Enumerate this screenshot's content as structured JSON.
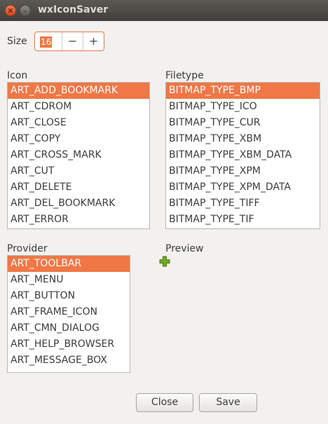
{
  "window": {
    "title": "wxIconSaver"
  },
  "size": {
    "label": "Size",
    "value": "16",
    "minus": "−",
    "plus": "+"
  },
  "icon_list": {
    "label": "Icon",
    "selected_index": 0,
    "items": [
      "ART_ADD_BOOKMARK",
      "ART_CDROM",
      "ART_CLOSE",
      "ART_COPY",
      "ART_CROSS_MARK",
      "ART_CUT",
      "ART_DELETE",
      "ART_DEL_BOOKMARK",
      "ART_ERROR"
    ]
  },
  "filetype_list": {
    "label": "Filetype",
    "selected_index": 0,
    "items": [
      "BITMAP_TYPE_BMP",
      "BITMAP_TYPE_ICO",
      "BITMAP_TYPE_CUR",
      "BITMAP_TYPE_XBM",
      "BITMAP_TYPE_XBM_DATA",
      "BITMAP_TYPE_XPM",
      "BITMAP_TYPE_XPM_DATA",
      "BITMAP_TYPE_TIFF",
      "BITMAP_TYPE_TIF"
    ]
  },
  "provider_list": {
    "label": "Provider",
    "selected_index": 0,
    "items": [
      "ART_TOOLBAR",
      "ART_MENU",
      "ART_BUTTON",
      "ART_FRAME_ICON",
      "ART_CMN_DIALOG",
      "ART_HELP_BROWSER",
      "ART_MESSAGE_BOX"
    ]
  },
  "preview": {
    "label": "Preview",
    "icon": "add-bookmark-icon",
    "icon_color": "#73a827"
  },
  "buttons": {
    "close": "Close",
    "save": "Save"
  },
  "colors": {
    "accent": "#f07746",
    "titlebar": "#4b4a46"
  }
}
